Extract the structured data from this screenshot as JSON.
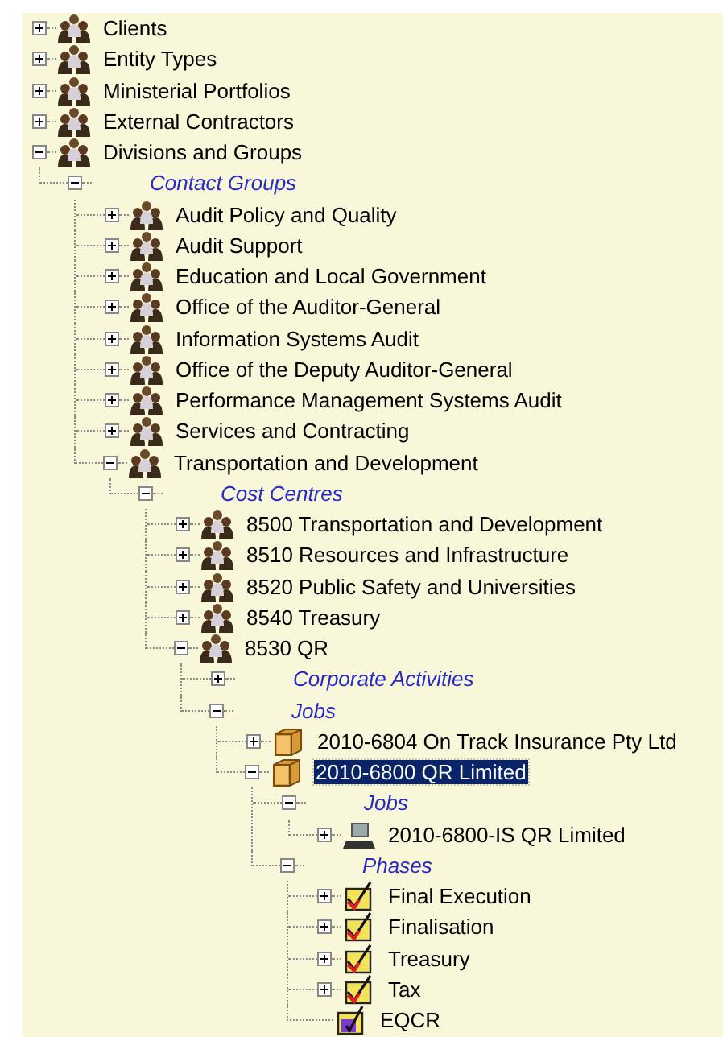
{
  "tree": [
    {
      "kind": "group",
      "label": "Clients",
      "expanded": false,
      "leaf": false,
      "selected": false
    },
    {
      "kind": "group",
      "label": "Entity Types",
      "expanded": false,
      "leaf": false,
      "selected": false
    },
    {
      "kind": "group",
      "label": "Ministerial Portfolios",
      "expanded": false,
      "leaf": false,
      "selected": false
    },
    {
      "kind": "group",
      "label": "External Contractors",
      "expanded": false,
      "leaf": false,
      "selected": false
    },
    {
      "kind": "group",
      "label": "Divisions and Groups",
      "expanded": true,
      "leaf": false,
      "selected": false,
      "children": [
        {
          "kind": "category",
          "label": "Contact Groups",
          "expanded": true,
          "leaf": false,
          "selected": false,
          "children": [
            {
              "kind": "group",
              "label": "Audit Policy and Quality",
              "expanded": false,
              "leaf": false,
              "selected": false
            },
            {
              "kind": "group",
              "label": "Audit Support",
              "expanded": false,
              "leaf": false,
              "selected": false
            },
            {
              "kind": "group",
              "label": "Education and Local Government",
              "expanded": false,
              "leaf": false,
              "selected": false
            },
            {
              "kind": "group",
              "label": "Office of the Auditor-General",
              "expanded": false,
              "leaf": false,
              "selected": false
            },
            {
              "kind": "group",
              "label": "Information Systems Audit",
              "expanded": false,
              "leaf": false,
              "selected": false
            },
            {
              "kind": "group",
              "label": "Office of the Deputy Auditor-General",
              "expanded": false,
              "leaf": false,
              "selected": false
            },
            {
              "kind": "group",
              "label": "Performance Management Systems Audit",
              "expanded": false,
              "leaf": false,
              "selected": false
            },
            {
              "kind": "group",
              "label": "Services and Contracting",
              "expanded": false,
              "leaf": false,
              "selected": false
            },
            {
              "kind": "group",
              "label": "Transportation and Development",
              "expanded": true,
              "leaf": false,
              "selected": false,
              "children": [
                {
                  "kind": "category",
                  "label": "Cost Centres",
                  "expanded": true,
                  "leaf": false,
                  "selected": false,
                  "children": [
                    {
                      "kind": "group",
                      "label": "8500 Transportation and Development",
                      "expanded": false,
                      "leaf": false,
                      "selected": false
                    },
                    {
                      "kind": "group",
                      "label": "8510 Resources and Infrastructure",
                      "expanded": false,
                      "leaf": false,
                      "selected": false
                    },
                    {
                      "kind": "group",
                      "label": "8520 Public Safety and Universities",
                      "expanded": false,
                      "leaf": false,
                      "selected": false
                    },
                    {
                      "kind": "group",
                      "label": "8540 Treasury",
                      "expanded": false,
                      "leaf": false,
                      "selected": false
                    },
                    {
                      "kind": "group",
                      "label": "8530 QR",
                      "expanded": true,
                      "leaf": false,
                      "selected": false,
                      "children": [
                        {
                          "kind": "category",
                          "label": "Corporate Activities",
                          "expanded": false,
                          "leaf": false,
                          "selected": false
                        },
                        {
                          "kind": "category",
                          "label": "Jobs",
                          "expanded": true,
                          "leaf": false,
                          "selected": false,
                          "children": [
                            {
                              "kind": "job",
                              "label": "2010-6804 On Track Insurance Pty Ltd",
                              "expanded": false,
                              "leaf": false,
                              "selected": false
                            },
                            {
                              "kind": "job",
                              "label": "2010-6800 QR Limited",
                              "expanded": true,
                              "leaf": false,
                              "selected": true,
                              "children": [
                                {
                                  "kind": "category",
                                  "label": "Jobs",
                                  "expanded": true,
                                  "leaf": false,
                                  "selected": false,
                                  "children": [
                                    {
                                      "kind": "resource",
                                      "label": "2010-6800-IS QR Limited",
                                      "expanded": false,
                                      "leaf": false,
                                      "selected": false
                                    }
                                  ]
                                },
                                {
                                  "kind": "category",
                                  "label": "Phases",
                                  "expanded": true,
                                  "leaf": false,
                                  "selected": false,
                                  "children": [
                                    {
                                      "kind": "phase",
                                      "label": "Final Execution",
                                      "expanded": false,
                                      "leaf": false,
                                      "selected": false
                                    },
                                    {
                                      "kind": "phase",
                                      "label": "Finalisation",
                                      "expanded": false,
                                      "leaf": false,
                                      "selected": false
                                    },
                                    {
                                      "kind": "phase",
                                      "label": "Treasury",
                                      "expanded": false,
                                      "leaf": false,
                                      "selected": false
                                    },
                                    {
                                      "kind": "phase",
                                      "label": "Tax",
                                      "expanded": false,
                                      "leaf": false,
                                      "selected": false
                                    },
                                    {
                                      "kind": "review",
                                      "label": "EQCR",
                                      "expanded": false,
                                      "leaf": true,
                                      "selected": false
                                    }
                                  ]
                                }
                              ]
                            }
                          ]
                        }
                      ]
                    }
                  ]
                }
              ]
            }
          ]
        }
      ]
    }
  ]
}
